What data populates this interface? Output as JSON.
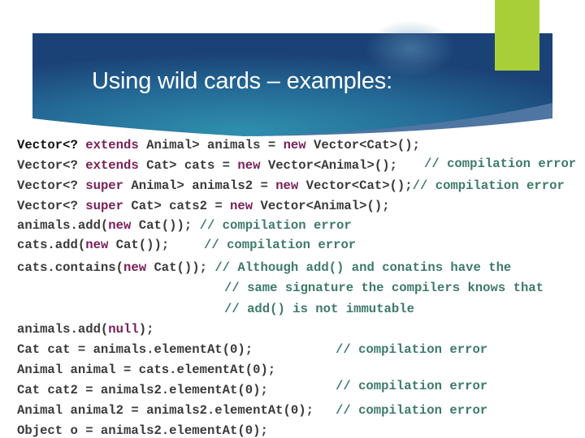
{
  "slide": {
    "title": "Using wild cards – examples:",
    "colors": {
      "banner_dark": "#1b4276",
      "banner_light": "#2d86a8",
      "accent": "#a9cf38",
      "keyword": "#7a1e56",
      "comment": "#3e7a6a",
      "code": "#3a3a3a"
    }
  },
  "code": {
    "lines": [
      {
        "segments": [
          {
            "t": "Vector<? "
          },
          {
            "t": "extends",
            "k": "kw"
          },
          {
            "t": " Animal> animals = "
          },
          {
            "t": "new",
            "k": "kw"
          },
          {
            "t": " Vector<Cat>();"
          }
        ]
      },
      {
        "segments": [
          {
            "t": "Vector<? "
          },
          {
            "t": "extends",
            "k": "kw"
          },
          {
            "t": " Cat> cats = "
          },
          {
            "t": "new",
            "k": "kw"
          },
          {
            "t": " Vector<Animal>();"
          }
        ]
      },
      {
        "segments": [
          {
            "t": "Vector<? "
          },
          {
            "t": "super",
            "k": "kw"
          },
          {
            "t": " Animal> animals2 = "
          },
          {
            "t": "new",
            "k": "kw"
          },
          {
            "t": " Vector<Cat>();"
          },
          {
            "t": "// compilation error",
            "k": "cm"
          }
        ]
      },
      {
        "segments": [
          {
            "t": "Vector<? "
          },
          {
            "t": "super",
            "k": "kw"
          },
          {
            "t": " Cat> cats2 = "
          },
          {
            "t": "new",
            "k": "kw"
          },
          {
            "t": " Vector<Animal>();"
          }
        ]
      },
      {
        "segments": [
          {
            "t": "animals.add("
          },
          {
            "t": "new",
            "k": "kw"
          },
          {
            "t": " Cat()); "
          },
          {
            "t": "// compilation error",
            "k": "cm"
          }
        ]
      },
      {
        "segments": [
          {
            "t": "cats.add("
          },
          {
            "t": "new",
            "k": "kw"
          },
          {
            "t": " Cat());"
          }
        ]
      },
      {
        "segments": [
          {
            "t": "cats.contains("
          },
          {
            "t": "new",
            "k": "kw"
          },
          {
            "t": " Cat()); "
          },
          {
            "t": "// Although add() and conatins have the",
            "k": "cm"
          }
        ]
      },
      {
        "segments": [
          {
            "t": "// same signature the compilers knows that",
            "k": "cm"
          }
        ]
      },
      {
        "segments": [
          {
            "t": "// add() is not immutable",
            "k": "cm"
          }
        ]
      },
      {
        "segments": [
          {
            "t": "animals.add("
          },
          {
            "t": "null",
            "k": "kw"
          },
          {
            "t": ");"
          }
        ]
      },
      {
        "segments": [
          {
            "t": "Cat cat = animals.elementAt(0);"
          }
        ]
      },
      {
        "segments": [
          {
            "t": "Animal animal = cats.elementAt(0);"
          }
        ]
      },
      {
        "segments": [
          {
            "t": "Cat cat2 = animals2.elementAt(0);"
          }
        ]
      },
      {
        "segments": [
          {
            "t": "Animal animal2 = animals2.elementAt(0);"
          }
        ]
      },
      {
        "segments": [
          {
            "t": "Object o = animals2.elementAt(0);"
          }
        ]
      }
    ],
    "side_comments": [
      {
        "text": "// compilation error",
        "line": 1
      },
      {
        "text": "// compilation error",
        "line": 5
      },
      {
        "text": "// compilation error",
        "line": 10
      },
      {
        "text": "// compilation error",
        "line": 12
      },
      {
        "text": "// compilation error",
        "line": 13
      }
    ]
  }
}
